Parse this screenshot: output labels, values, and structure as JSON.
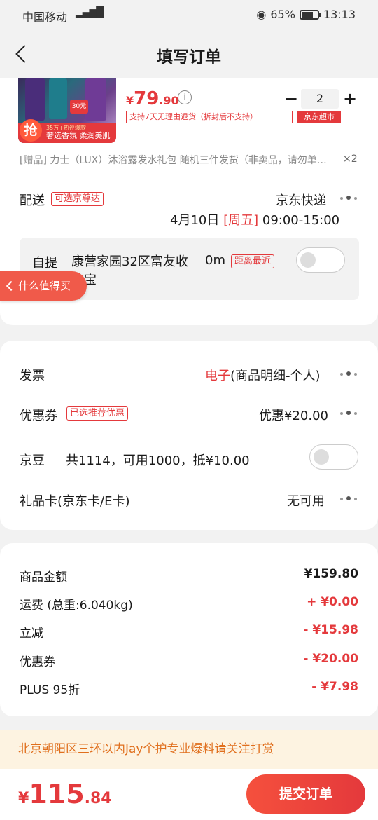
{
  "status_bar": {
    "carrier": "中国移动",
    "network": "4G",
    "battery": "65%",
    "time": "13:13"
  },
  "nav": {
    "title": "填写订单"
  },
  "product": {
    "price_symbol": "¥",
    "price_int": "79",
    "price_dec": ".90",
    "qty": "2",
    "return_tag": "支持7天无理由退货（拆封后不支持）",
    "market_tag": "京东超市",
    "thumb_badge": "抢",
    "thumb_sales": "35万+热评爆款",
    "thumb_slogan": "奢选香氛 柔润美肌",
    "thumb_price_tag": "30元",
    "gift_text": "[赠品] 力士（LUX）沐浴露发水礼包 随机三件发货（非卖品，请勿单拍）",
    "gift_qty": "×2"
  },
  "delivery": {
    "label": "配送",
    "tag": "可选京尊达",
    "method": "京东快递",
    "date": "4月10日",
    "weekday": "[周五]",
    "time_slot": "09:00-15:00"
  },
  "pickup": {
    "label": "自提",
    "location": "康营家园32区富友收件宝",
    "distance": "0m",
    "tag": "距离最近"
  },
  "float_tab": {
    "label": "什么值得买"
  },
  "invoice": {
    "label": "发票",
    "type": "电子",
    "detail": "(商品明细-个人)"
  },
  "coupon": {
    "label": "优惠券",
    "tag": "已选推荐优惠",
    "value": "优惠¥20.00"
  },
  "jingdou": {
    "label": "京豆",
    "detail": "共1114，可用1000，抵¥10.00"
  },
  "gift_card": {
    "label": "礼品卡(京东卡/E卡)",
    "value": "无可用"
  },
  "summary": [
    {
      "label": "商品金额",
      "value": "¥159.80",
      "red": false
    },
    {
      "label": "运费 (总重:6.040kg)",
      "value": "+ ¥0.00",
      "red": true
    },
    {
      "label": "立减",
      "value": "- ¥15.98",
      "red": true
    },
    {
      "label": "优惠券",
      "value": "- ¥20.00",
      "red": true
    },
    {
      "label": "PLUS 95折",
      "value": "- ¥7.98",
      "red": true
    }
  ],
  "announcement": "北京朝阳区三环以内Jay个护专业爆料请关注打赏",
  "footer": {
    "total_symbol": "¥",
    "total_int": "115",
    "total_dec": ".84",
    "submit_label": "提交订单"
  },
  "colors": {
    "accent": "#e4393c",
    "announce_bg": "#fdf3e1",
    "announce_text": "#e06f1d"
  }
}
